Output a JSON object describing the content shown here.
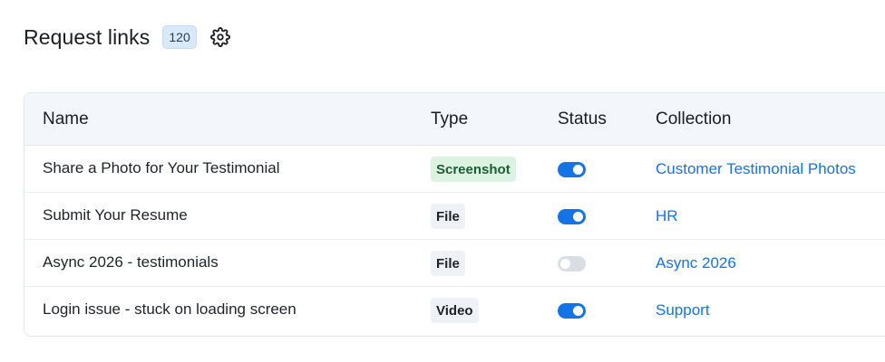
{
  "header": {
    "title": "Request links",
    "count": "120",
    "settings_icon": "gear-icon"
  },
  "table": {
    "columns": {
      "name": "Name",
      "type": "Type",
      "status": "Status",
      "collection": "Collection"
    },
    "rows": [
      {
        "name": "Share a Photo for Your Testimonial",
        "type": "Screenshot",
        "status_on": true,
        "collection": "Customer Testimonial Photos"
      },
      {
        "name": "Submit Your Resume",
        "type": "File",
        "status_on": true,
        "collection": "HR"
      },
      {
        "name": "Async 2026 - testimonials",
        "type": "File",
        "status_on": false,
        "collection": "Async 2026"
      },
      {
        "name": "Login issue - stuck on loading screen",
        "type": "Video",
        "status_on": true,
        "collection": "Support"
      }
    ]
  },
  "colors": {
    "accent": "#1473e6",
    "screenshot_tag_bg": "#dcf3e2",
    "count_badge_bg": "#d8e9fb",
    "toggle_off": "#d9dee5"
  }
}
